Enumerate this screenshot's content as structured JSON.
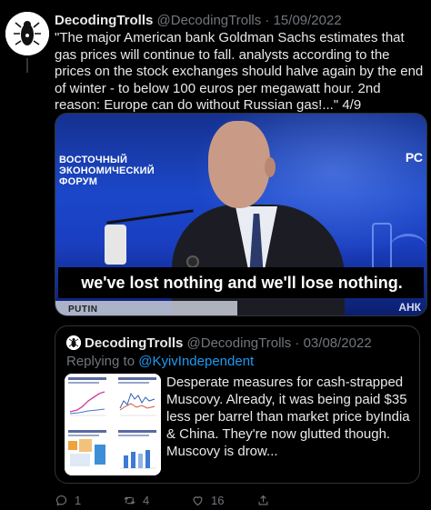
{
  "tweet": {
    "display_name": "DecodingTrolls",
    "handle": "@DecodingTrolls",
    "separator": "·",
    "date": "15/09/2022",
    "text": "\"The major American bank Goldman Sachs estimates that gas prices will continue to fall. analysts according to the prices on the stock exchanges should halve again by the end of winter - to below 100 euros per megawatt hour. 2nd reason: Europe can do without Russian gas!...\" 4/9"
  },
  "video": {
    "event_title_line1": "ВОСТОЧНЫЙ",
    "event_title_line2": "ЭКОНОМИЧЕСКИЙ",
    "event_title_line3": "ФОРУМ",
    "logo_right": "РС",
    "subtitle": "we've lost nothing and we'll lose nothing.",
    "speaker": "PUTIN",
    "tag_right": "АНК"
  },
  "quoted_tweet": {
    "display_name": "DecodingTrolls",
    "handle": "@DecodingTrolls",
    "separator": "·",
    "date": "03/08/2022",
    "replying_prefix": "Replying to ",
    "replying_to": "@KyivIndependent",
    "text": "Desperate measures for cash-strapped Muscovy. Already, it was being paid $35 less per barrel than market price byIndia & China. They're now glutted though. Muscovy is drow..."
  },
  "actions": {
    "reply_count": "1",
    "retweet_count": "4",
    "like_count": "16",
    "reply_icon": "reply-icon",
    "retweet_icon": "retweet-icon",
    "like_icon": "heart-icon",
    "share_icon": "share-icon"
  },
  "colors": {
    "background": "#000000",
    "text": "#e7e9ea",
    "muted": "#71767b",
    "link": "#1d9bf0",
    "border": "#2f3336"
  }
}
